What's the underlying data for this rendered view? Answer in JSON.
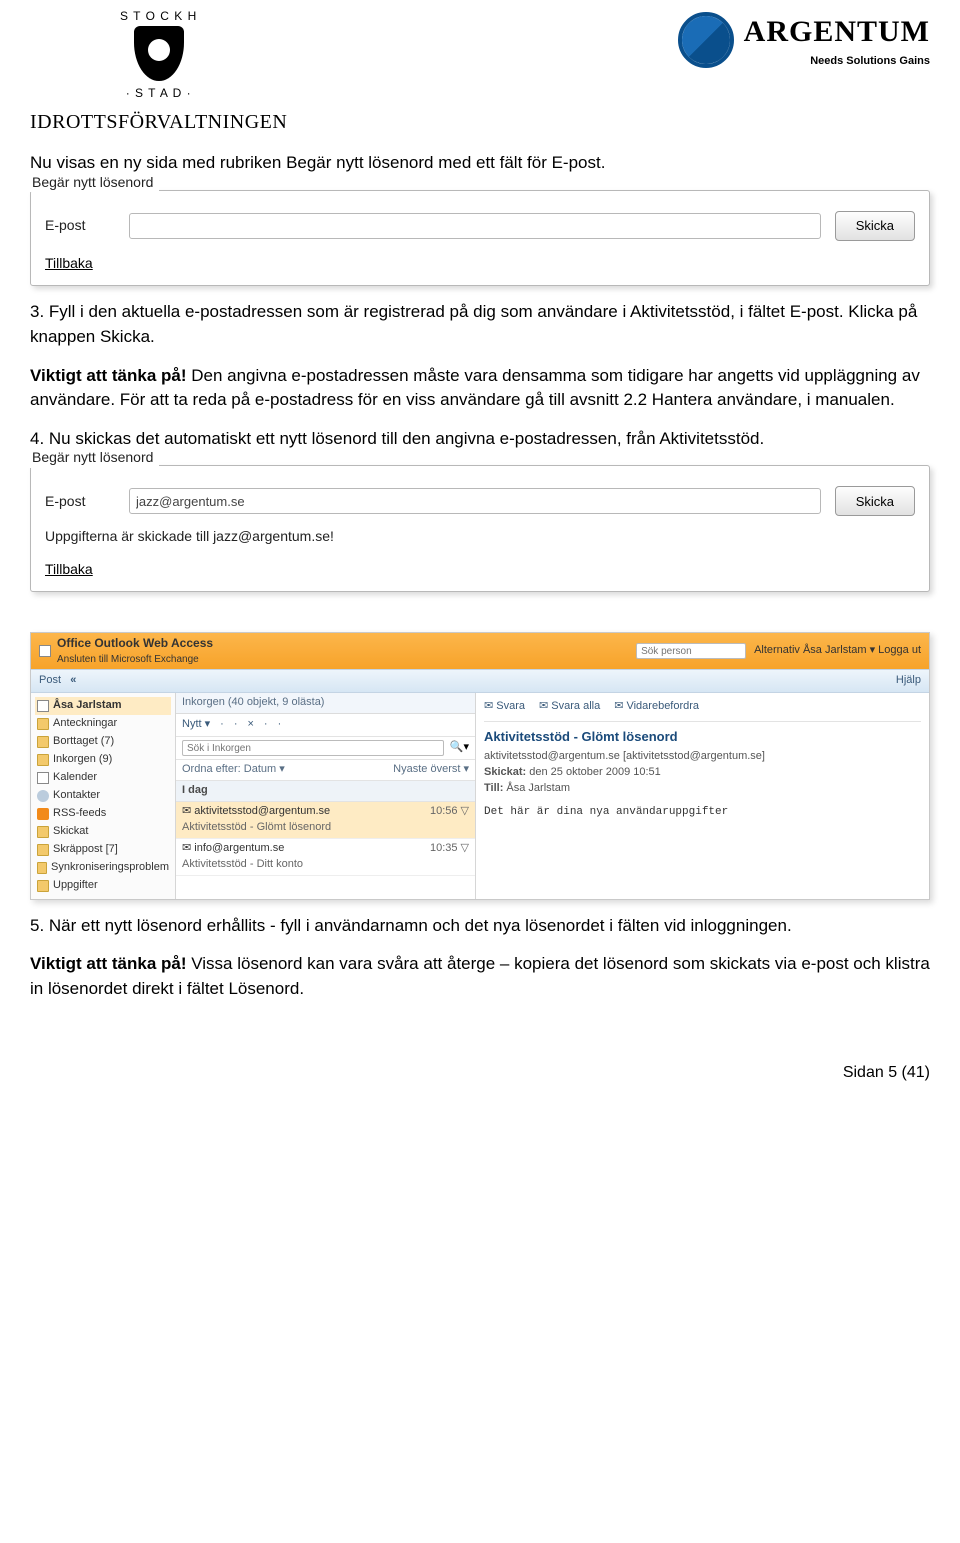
{
  "header": {
    "crest_top_text": "S T O C K H O L M",
    "crest_bottom_text": "· S T A D ·",
    "department": "IDROTTSFÖRVALTNINGEN",
    "argentum_name": "ARGENTUM",
    "argentum_tagline": "Needs  Solutions  Gains"
  },
  "content": {
    "intro": "Nu visas en ny sida med rubriken Begär nytt lösenord med ett fält för E-post.",
    "fieldset1": {
      "legend": "Begär nytt lösenord",
      "email_label": "E-post",
      "email_value": "",
      "submit_label": "Skicka",
      "back_label": "Tillbaka"
    },
    "step3": "3. Fyll i den aktuella e-postadressen som är registrerad på dig som användare i Aktivitetsstöd, i fältet E-post. Klicka på knappen Skicka.",
    "viktigt1_label": "Viktigt att tänka på!",
    "viktigt1_text": " Den angivna e-postadressen måste vara densamma som tidigare har angetts vid uppläggning av användare. För att ta reda på e-postadress för en viss användare gå till avsnitt 2.2 Hantera användare, i manualen.",
    "step4": "4. Nu skickas det automatiskt ett nytt lösenord till den angivna e-postadressen, från Aktivitetsstöd.",
    "fieldset2": {
      "legend": "Begär nytt lösenord",
      "email_label": "E-post",
      "email_value": "jazz@argentum.se",
      "submit_label": "Skicka",
      "status": "Uppgifterna är skickade till jazz@argentum.se!",
      "back_label": "Tillbaka"
    },
    "step5": "5. När ett nytt lösenord erhållits - fyll i användarnamn och det nya lösenordet i fälten vid inloggningen.",
    "viktigt2_label": "Viktigt att tänka på!",
    "viktigt2_text": " Vissa lösenord kan vara svåra att återge – kopiera det lösenord som skickats via e-post och klistra in lösenordet direkt i fältet Lösenord."
  },
  "owa": {
    "title": "Office Outlook Web Access",
    "subtitle": "Ansluten till Microsoft Exchange",
    "search_placeholder": "Sök person",
    "top_right_links": "Alternativ   Åsa Jarlstam ▾   Logga ut",
    "post_label": "Post",
    "chevrons": "«",
    "help_label": "Hjälp",
    "sidebar": [
      {
        "icon": "mail",
        "label": "Åsa Jarlstam",
        "sel": true
      },
      {
        "icon": "folder",
        "label": "Anteckningar"
      },
      {
        "icon": "folder",
        "label": "Borttaget (7)"
      },
      {
        "icon": "folder",
        "label": "Inkorgen (9)"
      },
      {
        "icon": "cal",
        "label": "Kalender"
      },
      {
        "icon": "people",
        "label": "Kontakter"
      },
      {
        "icon": "rss",
        "label": "RSS-feeds"
      },
      {
        "icon": "folder",
        "label": "Skickat"
      },
      {
        "icon": "folder",
        "label": "Skräppost [7]"
      },
      {
        "icon": "folder",
        "label": "Synkroniseringsproblem"
      },
      {
        "icon": "folder",
        "label": "Uppgifter"
      }
    ],
    "mid": {
      "head": "Inkorgen (40 objekt, 9 olästa)",
      "toolbar": [
        "Nytt ▾",
        "·",
        "·",
        "×",
        "·",
        "·"
      ],
      "search_placeholder": "Sök i Inkorgen",
      "sort_left": "Ordna efter: Datum ▾",
      "sort_right": "Nyaste överst ▾",
      "group_label": "I dag",
      "messages": [
        {
          "from": "aktivitetsstod@argentum.se",
          "subject": "Aktivitetsstöd - Glömt lösenord",
          "time": "10:56",
          "sel": true,
          "icon": "▽"
        },
        {
          "from": "info@argentum.se",
          "subject": "Aktivitetsstöd - Ditt konto",
          "time": "10:35",
          "sel": false,
          "icon": "▽"
        }
      ]
    },
    "preview": {
      "toolbar": [
        "Svara",
        "Svara alla",
        "Vidarebefordra"
      ],
      "subject": "Aktivitetsstöd - Glömt lösenord",
      "from": "aktivitetsstod@argentum.se [aktivitetsstod@argentum.se]",
      "sent_label": "Skickat:",
      "sent_value": "den 25 oktober 2009 10:51",
      "to_label": "Till:",
      "to_value": "Åsa Jarlstam",
      "body": "Det här är dina nya användaruppgifter"
    }
  },
  "footer": {
    "page": "Sidan 5 (41)"
  }
}
